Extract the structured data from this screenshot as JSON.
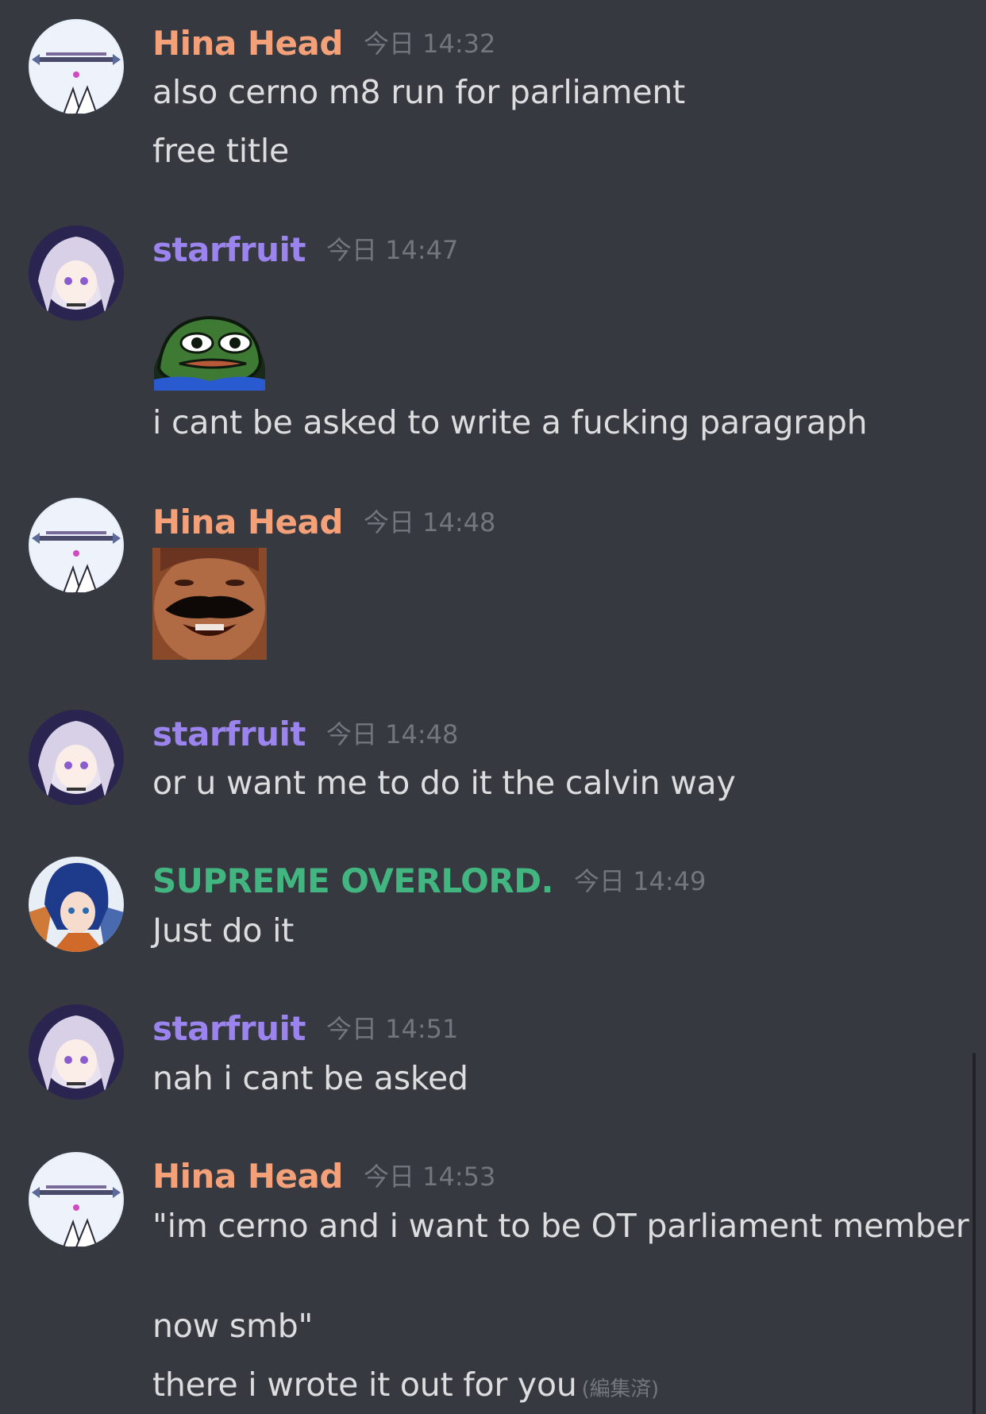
{
  "messages": [
    {
      "author": "Hina Head",
      "author_color": "#f4a078",
      "timestamp": "今日 14:32",
      "avatar_icon": "hina-avatar-icon",
      "lines": [
        "also cerno m8 run for parliament",
        "free title"
      ]
    },
    {
      "author": "starfruit",
      "author_color": "#9b84ee",
      "timestamp": "今日 14:47",
      "avatar_icon": "starfruit-avatar-icon",
      "emoji": "pepe-emoji-icon",
      "lines": [
        "i cant be asked to write a fucking paragraph"
      ]
    },
    {
      "author": "Hina Head",
      "author_color": "#f4a078",
      "timestamp": "今日 14:48",
      "avatar_icon": "hina-avatar-icon",
      "emoji": "laughing-man-emoji-icon",
      "lines": []
    },
    {
      "author": "starfruit",
      "author_color": "#9b84ee",
      "timestamp": "今日 14:48",
      "avatar_icon": "starfruit-avatar-icon",
      "lines": [
        "or u want me to do it the calvin way"
      ]
    },
    {
      "author": "SUPREME OVERLORD.",
      "author_color": "#43b581",
      "timestamp": "今日 14:49",
      "avatar_icon": "overlord-avatar-icon",
      "lines": [
        "Just do it"
      ]
    },
    {
      "author": "starfruit",
      "author_color": "#9b84ee",
      "timestamp": "今日 14:51",
      "avatar_icon": "starfruit-avatar-icon",
      "lines": [
        "nah i cant be asked"
      ]
    },
    {
      "author": "Hina Head",
      "author_color": "#f4a078",
      "timestamp": "今日 14:53",
      "avatar_icon": "hina-avatar-icon",
      "lines": [
        "\"im cerno and i want to be OT parliament member",
        "",
        "now smb\"",
        "there i wrote it out for you"
      ],
      "edited_label": "(編集済)"
    }
  ],
  "colors": {
    "background": "#36393f",
    "text": "#dcddde",
    "muted": "#72767d"
  }
}
